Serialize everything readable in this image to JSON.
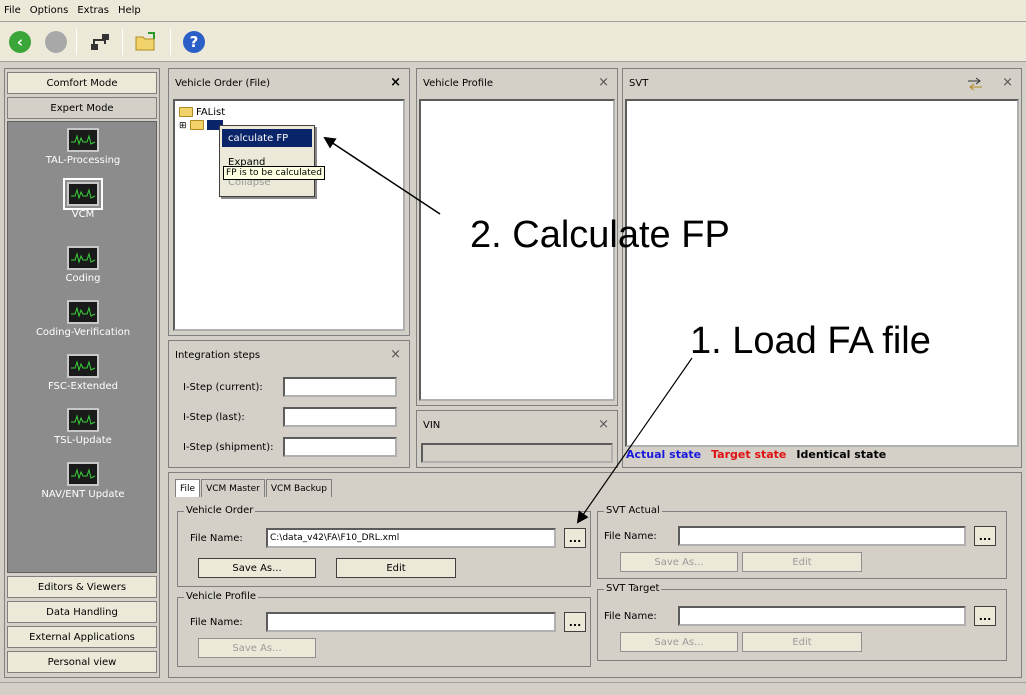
{
  "menu": {
    "items": [
      "File",
      "Options",
      "Extras",
      "Help"
    ]
  },
  "toolbar": {
    "icons": [
      "back-arrow-icon",
      "forward-icon",
      "network-icon",
      "open-folder-icon",
      "help-icon"
    ]
  },
  "sidebar": {
    "comfort_mode": "Comfort Mode",
    "expert_mode": "Expert Mode",
    "items": [
      "TAL-Processing",
      "VCM",
      "Coding",
      "Coding-Verification",
      "FSC-Extended",
      "TSL-Update",
      "NAV/ENT Update"
    ],
    "bottom": [
      "Editors & Viewers",
      "Data Handling",
      "External Applications",
      "Personal view"
    ]
  },
  "vehicle_order_panel": {
    "title": "Vehicle Order (File)",
    "close": "×",
    "tree_root": "FAList",
    "tree_expander": "⊞",
    "context_menu": {
      "selected": "calculate FP",
      "expand": "Expand",
      "collapse": "Collapse"
    },
    "tooltip": "FP is to be calculated"
  },
  "vehicle_profile_panel": {
    "title": "Vehicle Profile",
    "close": "×"
  },
  "svt_panel": {
    "title": "SVT",
    "close": "×",
    "legend": {
      "actual": "Actual state",
      "target": "Target state",
      "identical": "Identical state"
    },
    "legend_colors": {
      "actual": "#1a1adc",
      "target": "#e01010",
      "identical": "#000000"
    }
  },
  "integration_panel": {
    "title": "Integration steps",
    "close": "×",
    "current": "I-Step (current):",
    "last": "I-Step (last):",
    "shipment": "I-Step (shipment):"
  },
  "vin_panel": {
    "title": "VIN",
    "close": "×"
  },
  "bottom_tabs": {
    "file": "File",
    "vcm_master": "VCM Master",
    "vcm_backup": "VCM Backup"
  },
  "vehicle_order_group": {
    "label": "Vehicle Order",
    "file_name_label": "File Name:",
    "file_name_value": "C:\\data_v42\\FA\\F10_DRL.xml",
    "browse": "...",
    "save_as": "Save As...",
    "edit": "Edit"
  },
  "vehicle_profile_group": {
    "label": "Vehicle Profile",
    "file_name_label": "File Name:",
    "browse": "...",
    "save_as": "Save As..."
  },
  "svt_actual_group": {
    "label": "SVT Actual",
    "file_name_label": "File Name:",
    "browse": "...",
    "save_as": "Save As...",
    "edit": "Edit"
  },
  "svt_target_group": {
    "label": "SVT Target",
    "file_name_label": "File Name:",
    "browse": "...",
    "save_as": "Save As...",
    "edit": "Edit"
  },
  "annotations": {
    "step2": "2. Calculate FP",
    "step1": "1. Load FA file"
  }
}
